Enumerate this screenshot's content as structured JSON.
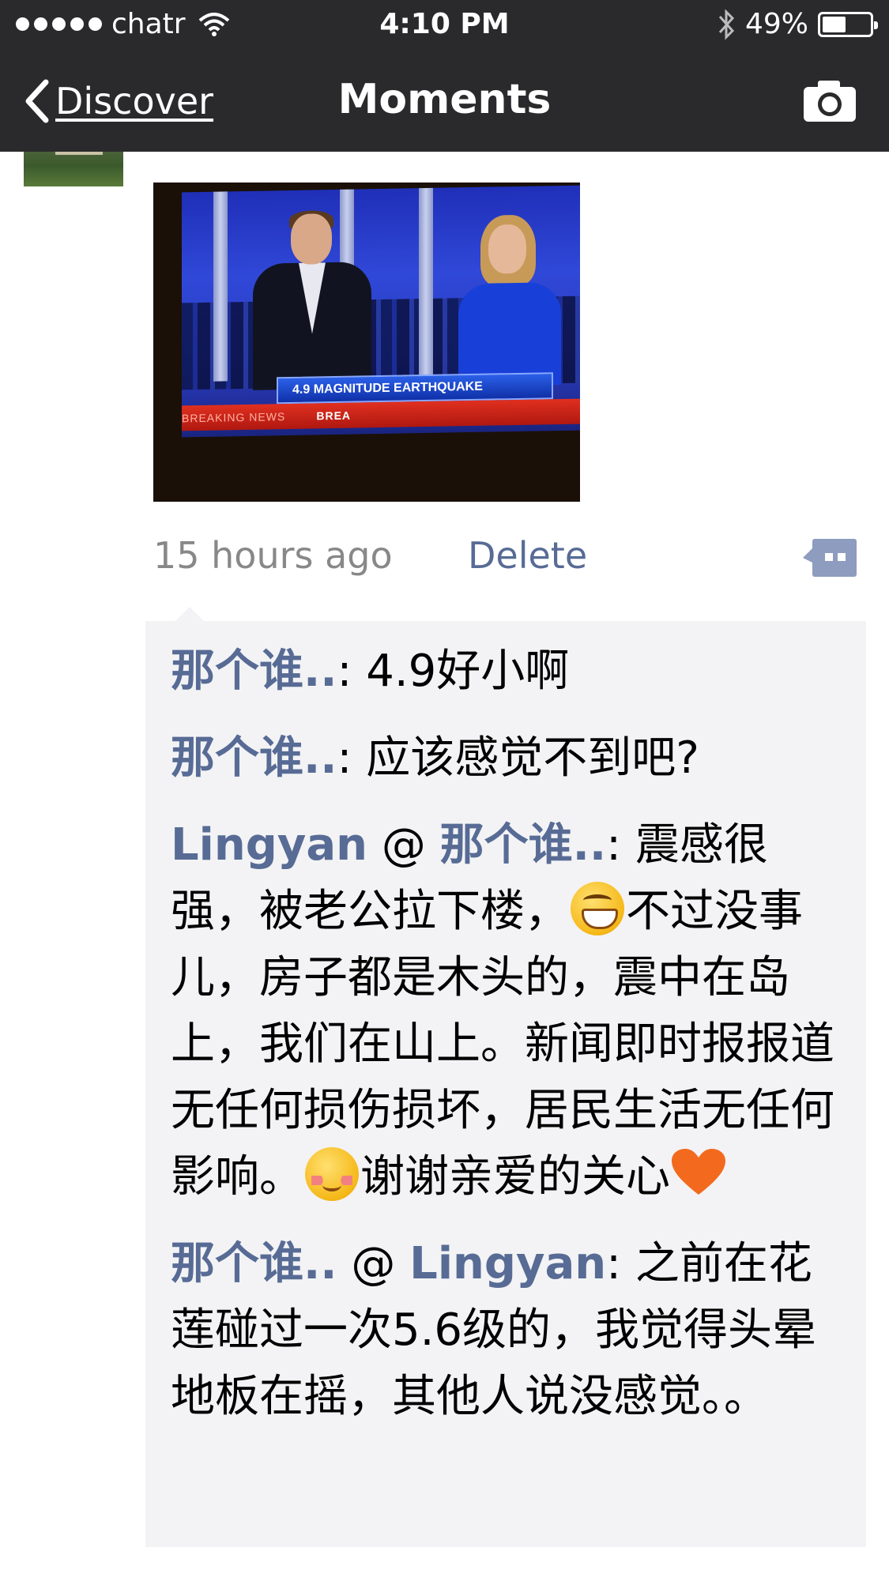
{
  "status_bar": {
    "carrier": "chatr",
    "time": "4:10 PM",
    "battery": "49%",
    "battery_level": 0.49
  },
  "nav": {
    "back_label": "Discover",
    "title": "Moments",
    "camera_icon": "camera-icon"
  },
  "post": {
    "photo_text": {
      "headline": "4.9 MAGNITUDE EARTHQUAKE",
      "ticker": "BREAKING NEWS",
      "ticker_live": "BREA"
    },
    "time_ago": "15 hours ago",
    "delete_label": "Delete"
  },
  "comments": [
    {
      "author": "那个谁..",
      "text": ": 4.9好小啊"
    },
    {
      "author": "那个谁..",
      "text": ": 应该感觉不到吧?"
    },
    {
      "author": "Lingyan",
      "reply_to": "那个谁..",
      "text_part1": ": 震感很强，被老公拉下楼，",
      "text_part2": "不过没事儿，房子都是木头的，震中在岛上，我们在山上。新闻即时报报道无任何损伤损坏，居民生活无任何影响。",
      "text_part3": "谢谢亲爱的关心"
    },
    {
      "author": "那个谁..",
      "reply_to": "Lingyan",
      "text": ": 之前在花莲碰过一次5.6级的，我觉得头晕地板在摇，其他人说没感觉。。"
    }
  ],
  "colors": {
    "nav_bg": "#2a2a2c",
    "link": "#576b95",
    "meta_gray": "#888888",
    "comment_bg": "#f3f3f5"
  }
}
